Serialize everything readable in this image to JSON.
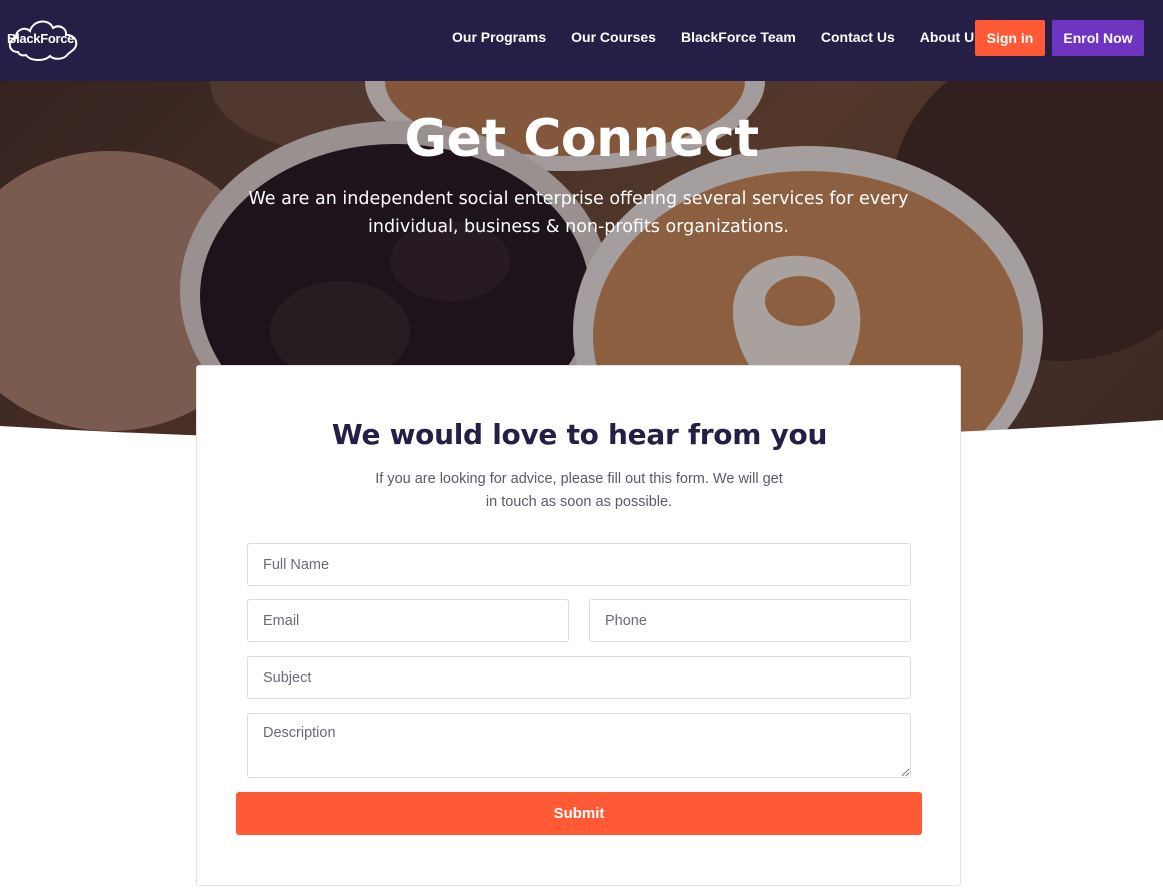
{
  "brand": {
    "logo_text": "BlackForce."
  },
  "nav": {
    "links": [
      "Our Programs",
      "Our Courses",
      "BlackForce Team",
      "Contact Us",
      "About Us"
    ],
    "signin_label": "Sign in",
    "enrol_label": "Enrol Now"
  },
  "hero": {
    "title": "Get Connect",
    "subtitle": "We are an independent social enterprise offering several services for every individual, business & non-profits organizations."
  },
  "form": {
    "title": "We would love to hear from you",
    "subtitle": "If you are looking for advice, please fill out this form. We will get in touch as soon as possible.",
    "full_name_placeholder": "Full Name",
    "email_placeholder": "Email",
    "phone_placeholder": "Phone",
    "subject_placeholder": "Subject",
    "description_placeholder": "Description",
    "submit_label": "Submit"
  },
  "colors": {
    "navbar": "#251f47",
    "accent_orange": "#ff5a35",
    "accent_purple": "#6f35c0"
  }
}
